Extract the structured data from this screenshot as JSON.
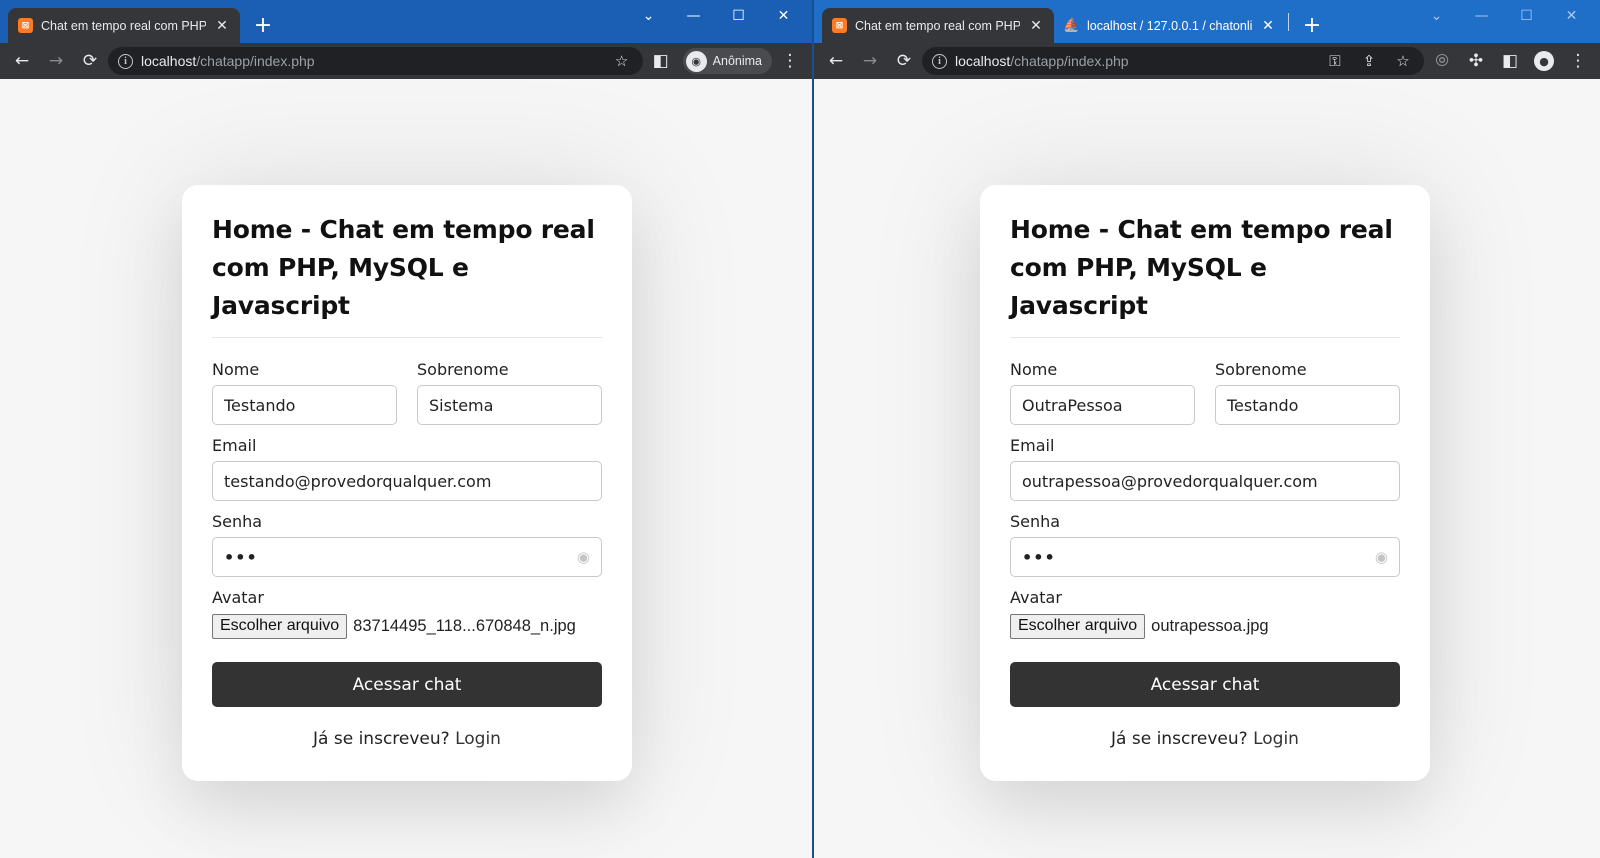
{
  "left_window": {
    "tab_title": "Chat em tempo real com PHP, MySQL e Javascript",
    "tab_favicon": "xampp-icon",
    "url_host": "localhost",
    "url_path": "/chatapp/index.php",
    "profile_label": "Anônima",
    "form": {
      "title": "Home - Chat em tempo real com PHP, MySQL e Javascript",
      "nome_label": "Nome",
      "nome_value": "Testando",
      "sobrenome_label": "Sobrenome",
      "sobrenome_value": "Sistema",
      "email_label": "Email",
      "email_value": "testando@provedorqualquer.com",
      "senha_label": "Senha",
      "senha_value": "•••",
      "avatar_label": "Avatar",
      "file_button": "Escolher arquivo",
      "file_name": "83714495_118...670848_n.jpg",
      "submit_label": "Acessar chat",
      "footer_text": "Já se inscreveu?",
      "footer_link": "Login"
    }
  },
  "right_window": {
    "tab1_title": "Chat em tempo real com PHP, MySQL e Javascript",
    "tab2_title": "localhost / 127.0.0.1 / chatonline",
    "url_host": "localhost",
    "url_path": "/chatapp/index.php",
    "form": {
      "title": "Home - Chat em tempo real com PHP, MySQL e Javascript",
      "nome_label": "Nome",
      "nome_value": "OutraPessoa",
      "sobrenome_label": "Sobrenome",
      "sobrenome_value": "Testando",
      "email_label": "Email",
      "email_value": "outrapessoa@provedorqualquer.com",
      "senha_label": "Senha",
      "senha_value": "•••",
      "avatar_label": "Avatar",
      "file_button": "Escolher arquivo",
      "file_name": "outrapessoa.jpg",
      "submit_label": "Acessar chat",
      "footer_text": "Já se inscreveu?",
      "footer_link": "Login"
    }
  },
  "icons": {
    "back": "←",
    "forward": "→",
    "reload": "⟳",
    "star": "☆",
    "close": "✕",
    "plus": "+",
    "menu": "⋮"
  },
  "colors": {
    "titlebar_left": "#1a5fb4",
    "titlebar_right": "#1f6fc8",
    "toolbar": "#35363a",
    "button": "#333333",
    "page_bg": "#f6f6f6"
  }
}
